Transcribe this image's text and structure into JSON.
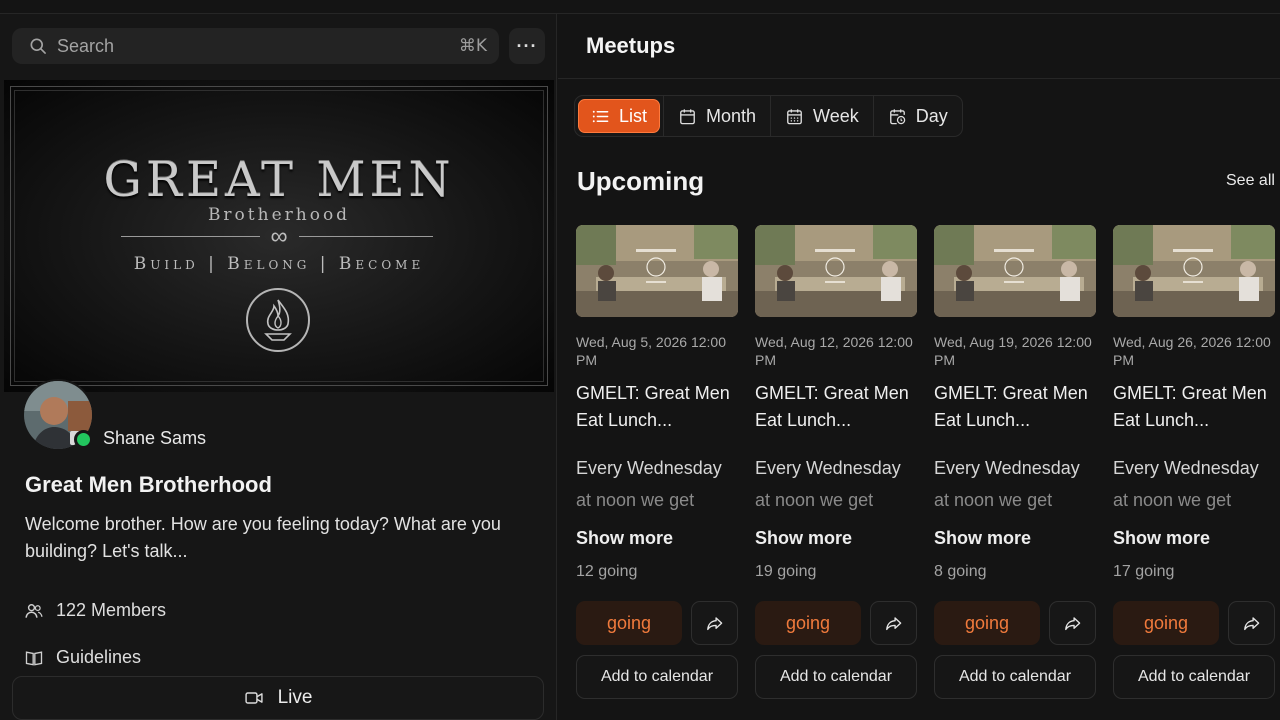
{
  "search": {
    "placeholder": "Search",
    "shortcut": "⌘K"
  },
  "more_menu": {
    "label": "···"
  },
  "banner": {
    "title": "GREAT MEN",
    "subtitle": "Brotherhood",
    "tagline": "Build | Belong | Become"
  },
  "owner": {
    "name": "Shane Sams",
    "status_color": "#22c55e"
  },
  "group": {
    "title": "Great Men Brotherhood",
    "description": "Welcome brother. How are you feeling today? What are you building? Let's talk...",
    "members": "122 Members",
    "guidelines": "Guidelines"
  },
  "live": {
    "label": "Live"
  },
  "meetups": {
    "title": "Meetups",
    "views": [
      {
        "label": "List",
        "icon": "list-icon",
        "active": true
      },
      {
        "label": "Month",
        "icon": "calendar-icon",
        "active": false
      },
      {
        "label": "Week",
        "icon": "calendar-grid-icon",
        "active": false
      },
      {
        "label": "Day",
        "icon": "calendar-clock-icon",
        "active": false
      }
    ],
    "section_title": "Upcoming",
    "see_all": "See all",
    "accent_color": "#e2551c",
    "events": [
      {
        "date": "Wed, Aug 5, 2026 12:00 PM",
        "title": "GMELT: Great Men Eat Lunch...",
        "desc_line1": "Every Wednesday",
        "desc_line2": "at noon we get",
        "show_more": "Show more",
        "going_count": "12 going",
        "going_label": "going",
        "calendar_label": "Add to calendar"
      },
      {
        "date": "Wed, Aug 12, 2026 12:00 PM",
        "title": "GMELT: Great Men Eat Lunch...",
        "desc_line1": "Every Wednesday",
        "desc_line2": "at noon we get",
        "show_more": "Show more",
        "going_count": "19 going",
        "going_label": "going",
        "calendar_label": "Add to calendar"
      },
      {
        "date": "Wed, Aug 19, 2026 12:00 PM",
        "title": "GMELT: Great Men Eat Lunch...",
        "desc_line1": "Every Wednesday",
        "desc_line2": "at noon we get",
        "show_more": "Show more",
        "going_count": "8 going",
        "going_label": "going",
        "calendar_label": "Add to calendar"
      },
      {
        "date": "Wed, Aug 26, 2026 12:00 PM",
        "title": "GMELT: Great Men Eat Lunch...",
        "desc_line1": "Every Wednesday",
        "desc_line2": "at noon we get",
        "show_more": "Show more",
        "going_count": "17 going",
        "going_label": "going",
        "calendar_label": "Add to calendar"
      }
    ]
  }
}
